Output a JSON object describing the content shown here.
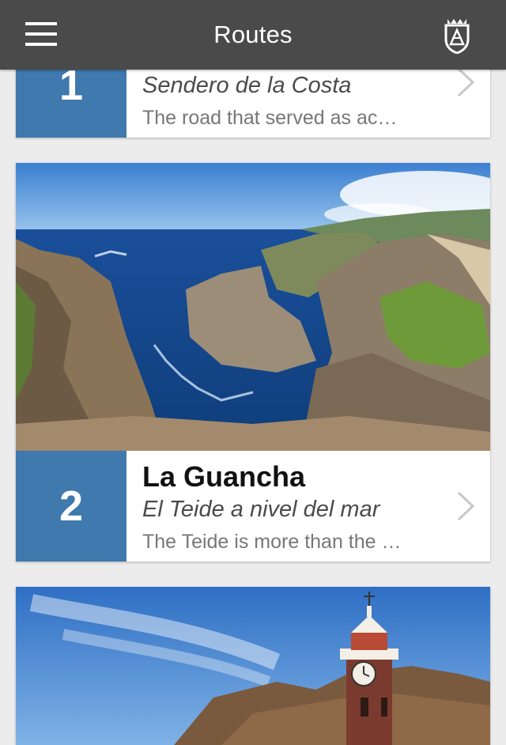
{
  "header": {
    "title": "Routes",
    "menu_icon": "hamburger-menu-icon",
    "crest_icon": "coat-of-arms-icon"
  },
  "routes": [
    {
      "number": "1",
      "name": "",
      "subtitle": "Sendero de la Costa",
      "description": "The road that served as ac…"
    },
    {
      "number": "2",
      "name": "La Guancha",
      "subtitle": "El Teide a nivel del mar",
      "description": "The Teide is more than the …",
      "image": "coastal-cliffs-photo"
    },
    {
      "image": "church-clock-tower-photo"
    }
  ],
  "colors": {
    "header_bg": "#4a4a4a",
    "number_bg": "#3f79ad",
    "page_bg": "#ececec"
  }
}
